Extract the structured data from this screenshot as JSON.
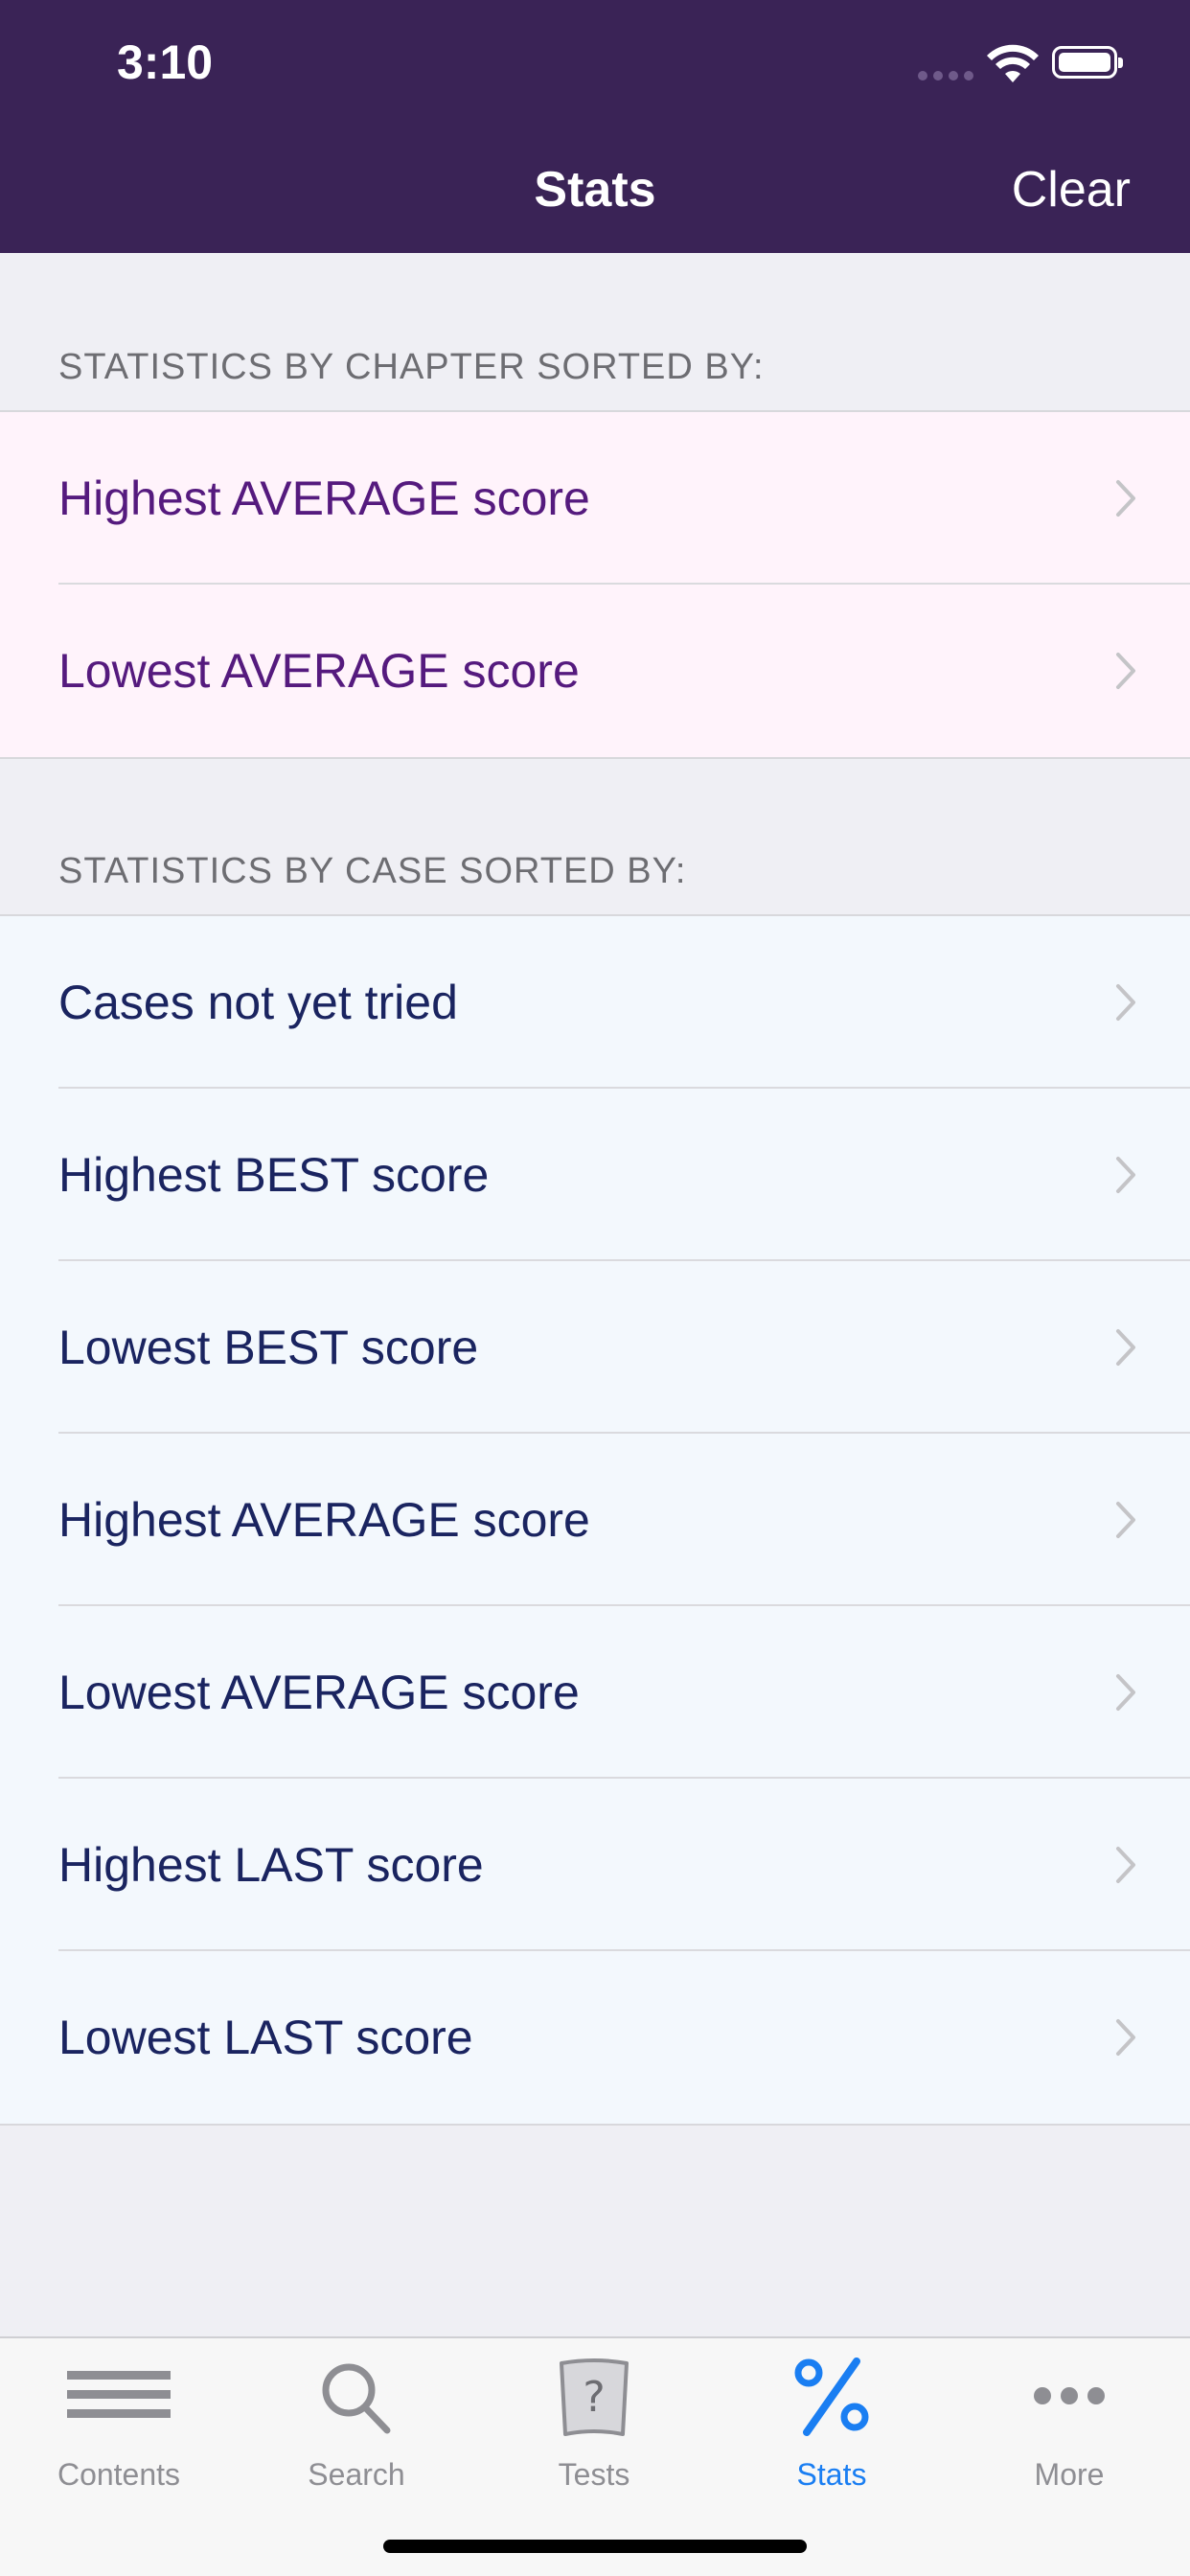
{
  "status_bar": {
    "time": "3:10"
  },
  "nav": {
    "title": "Stats",
    "clear_label": "Clear"
  },
  "chapter_section": {
    "header": "STATISTICS BY CHAPTER SORTED BY:",
    "items": [
      {
        "label": "Highest AVERAGE score"
      },
      {
        "label": "Lowest AVERAGE score"
      }
    ]
  },
  "case_section": {
    "header": "STATISTICS BY CASE SORTED BY:",
    "items": [
      {
        "label": "Cases not yet tried"
      },
      {
        "label": "Highest BEST score"
      },
      {
        "label": "Lowest BEST score"
      },
      {
        "label": "Highest AVERAGE score"
      },
      {
        "label": "Lowest AVERAGE score"
      },
      {
        "label": "Highest LAST score"
      },
      {
        "label": "Lowest LAST score"
      }
    ]
  },
  "tabbar": {
    "tabs": [
      {
        "label": "Contents",
        "icon": "contents-icon"
      },
      {
        "label": "Search",
        "icon": "search-icon"
      },
      {
        "label": "Tests",
        "icon": "tests-icon"
      },
      {
        "label": "Stats",
        "icon": "percent-icon"
      },
      {
        "label": "More",
        "icon": "more-icon"
      }
    ],
    "active_color": "#1a7ef2",
    "inactive_color": "#8e8e93"
  },
  "colors": {
    "header_bg": "#3a2356",
    "chapter_row_bg": "#fff3fb",
    "chapter_text": "#551a7e",
    "case_row_bg": "#f3f8fd",
    "case_text": "#1a2460"
  }
}
